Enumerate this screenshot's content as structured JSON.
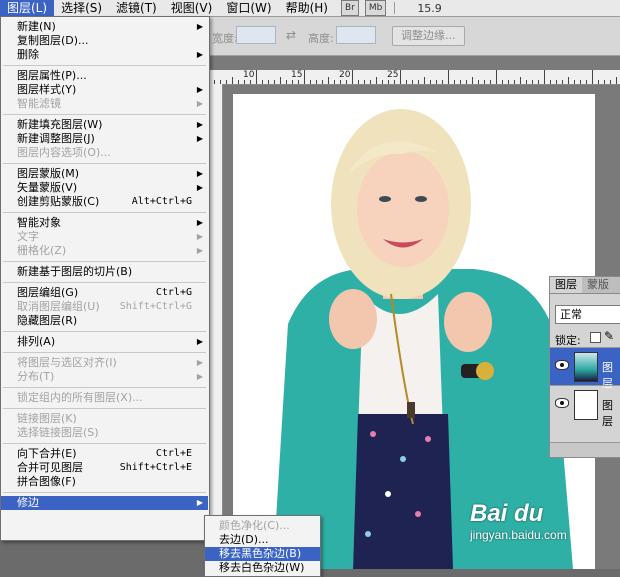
{
  "menubar": {
    "items": [
      {
        "label": "图层(L)",
        "active": true
      },
      {
        "label": "选择(S)"
      },
      {
        "label": "滤镜(T)"
      },
      {
        "label": "视图(V)"
      },
      {
        "label": "窗口(W)"
      },
      {
        "label": "帮助(H)"
      }
    ],
    "br_label": "Br",
    "mb_label": "Mb",
    "zoom": "15.9"
  },
  "options": {
    "width_label": "宽度:",
    "height_label": "高度:",
    "refine_edge_label": "调整边缘..."
  },
  "layer_menu": {
    "items": [
      {
        "label": "新建(N)",
        "submenu": true
      },
      {
        "label": "复制图层(D)..."
      },
      {
        "label": "删除",
        "submenu": true
      },
      {
        "sep": true
      },
      {
        "label": "图层属性(P)..."
      },
      {
        "label": "图层样式(Y)",
        "submenu": true
      },
      {
        "label": "智能滤镜",
        "disabled": true,
        "submenu": true
      },
      {
        "sep": true
      },
      {
        "label": "新建填充图层(W)",
        "submenu": true
      },
      {
        "label": "新建调整图层(J)",
        "submenu": true
      },
      {
        "label": "图层内容选项(O)...",
        "disabled": true
      },
      {
        "sep": true
      },
      {
        "label": "图层蒙版(M)",
        "submenu": true
      },
      {
        "label": "矢量蒙版(V)",
        "submenu": true
      },
      {
        "label": "创建剪贴蒙版(C)",
        "shortcut": "Alt+Ctrl+G"
      },
      {
        "sep": true
      },
      {
        "label": "智能对象",
        "submenu": true
      },
      {
        "label": "文字",
        "disabled": true,
        "submenu": true
      },
      {
        "label": "栅格化(Z)",
        "disabled": true,
        "submenu": true
      },
      {
        "sep": true
      },
      {
        "label": "新建基于图层的切片(B)"
      },
      {
        "sep": true
      },
      {
        "label": "图层编组(G)",
        "shortcut": "Ctrl+G"
      },
      {
        "label": "取消图层编组(U)",
        "shortcut": "Shift+Ctrl+G",
        "disabled": true
      },
      {
        "label": "隐藏图层(R)"
      },
      {
        "sep": true
      },
      {
        "label": "排列(A)",
        "submenu": true
      },
      {
        "sep": true
      },
      {
        "label": "将图层与选区对齐(I)",
        "disabled": true,
        "submenu": true
      },
      {
        "label": "分布(T)",
        "disabled": true,
        "submenu": true
      },
      {
        "sep": true
      },
      {
        "label": "锁定组内的所有图层(X)...",
        "disabled": true
      },
      {
        "sep": true
      },
      {
        "label": "链接图层(K)",
        "disabled": true
      },
      {
        "label": "选择链接图层(S)",
        "disabled": true
      },
      {
        "sep": true
      },
      {
        "label": "向下合并(E)",
        "shortcut": "Ctrl+E"
      },
      {
        "label": "合并可见图层",
        "shortcut": "Shift+Ctrl+E"
      },
      {
        "label": "拼合图像(F)"
      },
      {
        "sep": true
      },
      {
        "label": "修边",
        "submenu": true,
        "highlighted": true
      }
    ]
  },
  "matting_submenu": {
    "items": [
      {
        "label": "颜色净化(C)...",
        "disabled": true
      },
      {
        "label": "去边(D)..."
      },
      {
        "label": "移去黑色杂边(B)",
        "highlighted": true
      },
      {
        "label": "移去白色杂边(W)"
      }
    ]
  },
  "ruler": {
    "numbers": [
      "10",
      "15",
      "20",
      "25"
    ]
  },
  "layers_panel": {
    "tab_layers": "图层",
    "tab_other": "蒙版",
    "blend_mode": "正常",
    "lock_label": "锁定:",
    "layer_top_name": "图层",
    "layer_bottom_name": "图层"
  },
  "watermark": {
    "logo": "Bai du",
    "url": "jingyan.baidu.com"
  },
  "colors": {
    "highlight": "#3a63c4",
    "menu_bg": "#f3f3f3",
    "teal": "#2aa7a0"
  }
}
